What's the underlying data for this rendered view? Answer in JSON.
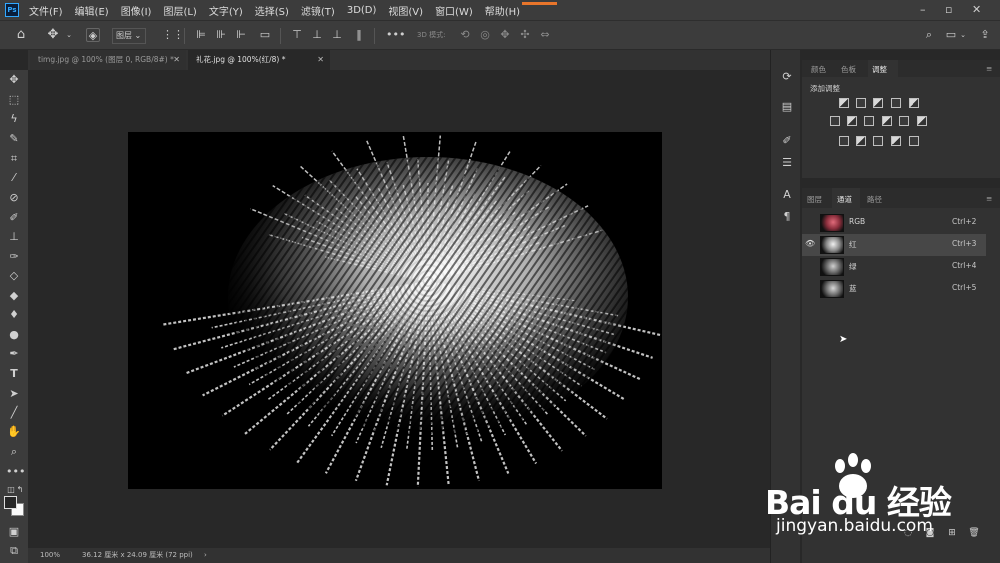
{
  "app": {
    "logo": "Ps",
    "menu": [
      "文件(F)",
      "编辑(E)",
      "图像(I)",
      "图层(L)",
      "文字(Y)",
      "选择(S)",
      "滤镜(T)",
      "3D(D)",
      "视图(V)",
      "窗口(W)",
      "帮助(H)"
    ],
    "window_controls": [
      "minimize-icon",
      "restore-icon",
      "close-icon"
    ]
  },
  "options_bar": {
    "layer_select": "图层",
    "mode_3d": "3D 模式:",
    "icons": [
      "home-icon",
      "move-icon",
      "auto-select-icon",
      "grid-icon",
      "align-left-icon",
      "align-center-icon",
      "align-right-icon",
      "distribute-icon",
      "more-icon",
      "orbit-icon",
      "roll-icon",
      "pan-icon",
      "slide-icon",
      "scale-icon",
      "search-icon",
      "workspace-icon",
      "share-icon"
    ]
  },
  "tabs": [
    {
      "label": "timg.jpg @ 100% (图层 0, RGB/8#) *",
      "active": false
    },
    {
      "label": "礼花.jpg @ 100%(红/8) *",
      "active": true
    }
  ],
  "status_bar": {
    "zoom": "100%",
    "doc_info": "36.12 厘米 x 24.09 厘米 (72 ppi)",
    "arrow": "›"
  },
  "adjustments_panel": {
    "tabs": [
      "颜色",
      "色板",
      "调整"
    ],
    "active_tab": "调整",
    "title": "添加调整"
  },
  "channels_panel": {
    "tabs": [
      "图层",
      "通道",
      "路径"
    ],
    "active_tab": "通道",
    "channels": [
      {
        "name": "RGB",
        "shortcut": "Ctrl+2",
        "visible": false,
        "selected": false
      },
      {
        "name": "红",
        "shortcut": "Ctrl+3",
        "visible": true,
        "selected": true
      },
      {
        "name": "绿",
        "shortcut": "Ctrl+4",
        "visible": false,
        "selected": false
      },
      {
        "name": "蓝",
        "shortcut": "Ctrl+5",
        "visible": false,
        "selected": false
      }
    ]
  },
  "watermark": {
    "brand": "Bai du 经验",
    "url": "jingyan.baidu.com"
  },
  "colors": {
    "accent": "#31a8ff",
    "progress": "#e8752b",
    "panel_bg": "#323232",
    "canvas_bg": "#282828",
    "selected_row": "#474747"
  }
}
